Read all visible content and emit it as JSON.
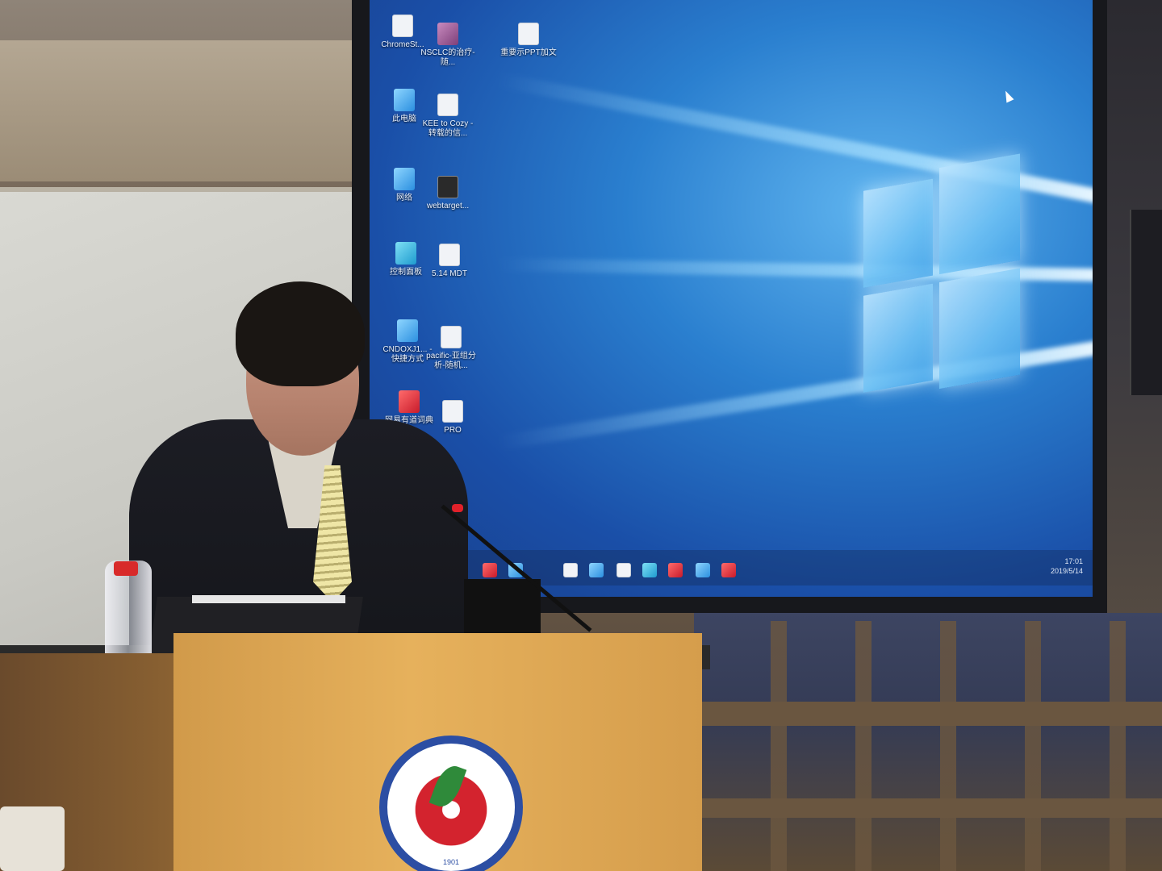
{
  "scene": {
    "description_colors": {
      "screen_blue": "#2a7fcf",
      "podium_wood": "#e6b15c",
      "emblem_blue": "#2c4ea3",
      "emblem_red": "#d3232e"
    }
  },
  "desktop": {
    "icons": [
      {
        "label": "ChromeSt...",
        "icon": "app-icon"
      },
      {
        "label": "NSCLC的治疗-随...",
        "icon": "document-icon"
      },
      {
        "label": "此电脑",
        "icon": "computer-icon"
      },
      {
        "label": "KEE to Cozy -转载的信...",
        "icon": "document-icon"
      },
      {
        "label": "网络",
        "icon": "network-icon"
      },
      {
        "label": "webtarget...",
        "icon": "app-icon"
      },
      {
        "label": "控制面板",
        "icon": "control-panel-icon"
      },
      {
        "label": "5.14 MDT",
        "icon": "file-icon"
      },
      {
        "label": "CNDOXJ1... -快捷方式",
        "icon": "shortcut-icon"
      },
      {
        "label": "pacific-亚组分析-随机...",
        "icon": "folder-icon"
      },
      {
        "label": "网易有道词典",
        "icon": "dictionary-icon"
      },
      {
        "label": "PRO",
        "icon": "folder-icon"
      },
      {
        "label": "重要示PPT加文",
        "icon": "file-icon"
      }
    ]
  },
  "taskbar": {
    "time": "17:01",
    "date": "2019/5/14"
  },
  "emblem": {
    "year": "1901"
  }
}
